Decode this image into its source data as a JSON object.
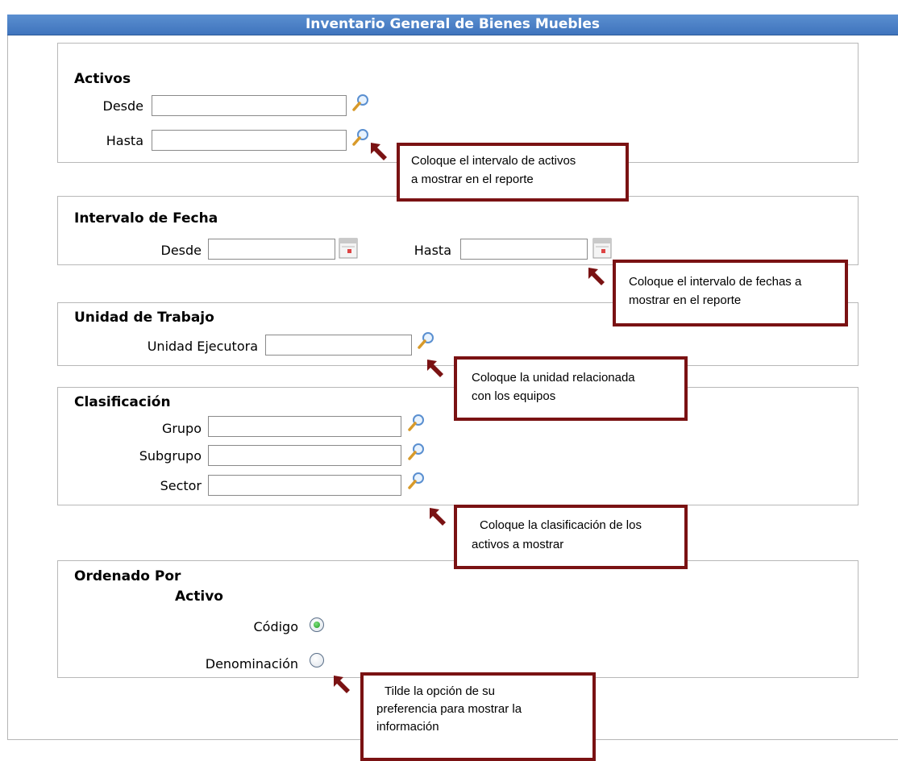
{
  "title": "Inventario General de Bienes Muebles",
  "activos": {
    "title": "Activos",
    "desde_label": "Desde",
    "desde_value": "",
    "hasta_label": "Hasta",
    "hasta_value": ""
  },
  "fecha": {
    "title": "Intervalo de Fecha",
    "desde_label": "Desde",
    "desde_value": "",
    "hasta_label": "Hasta",
    "hasta_value": ""
  },
  "unidad": {
    "title": "Unidad de Trabajo",
    "ejecutora_label": "Unidad Ejecutora",
    "ejecutora_value": ""
  },
  "clasificacion": {
    "title": "Clasificación",
    "grupo_label": "Grupo",
    "grupo_value": "",
    "subgrupo_label": "Subgrupo",
    "subgrupo_value": "",
    "sector_label": "Sector",
    "sector_value": ""
  },
  "ordenado": {
    "title": "Ordenado Por",
    "subtitle": "Activo",
    "options": [
      {
        "label": "Código",
        "selected": true
      },
      {
        "label": "Denominación",
        "selected": false
      }
    ]
  },
  "callouts": {
    "activos": [
      "Coloque el intervalo de activos",
      "a  mostrar en el reporte"
    ],
    "fechas": [
      "Coloque el intervalo de fechas a",
      "mostrar en el reporte"
    ],
    "unidad": [
      "Coloque la unidad  relacionada",
      "con los equipos"
    ],
    "clasificacion": [
      "Coloque la clasificación de los",
      "activos a mostrar"
    ],
    "opcion": [
      "Tilde  la  opción  de  su",
      "preferencia  para  mostrar  la",
      "información"
    ]
  },
  "colors": {
    "titlebar": "#3f74bd",
    "callout_border": "#7a1213",
    "radio_selected": "#1f9a1f"
  },
  "icons": [
    "magnifier-icon",
    "calendar-icon",
    "arrow-pointer-icon"
  ]
}
